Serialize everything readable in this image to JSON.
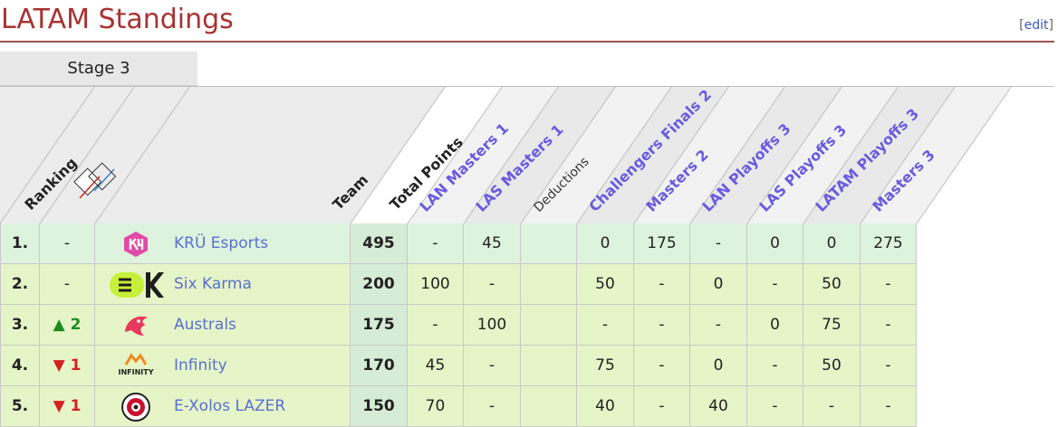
{
  "title": "LATAM Standings",
  "edit": {
    "open": "[",
    "label": "edit",
    "close": "]"
  },
  "tab": {
    "label": "Stage 3"
  },
  "header": {
    "ranking": "Ranking",
    "team": "Team",
    "total_points": "Total Points",
    "columns": [
      "LAN Masters 1",
      "LAS Masters 1",
      "Deductions",
      "Challengers Finals 2",
      "Masters 2",
      "LAN Playoffs 3",
      "LAS Playoffs 3",
      "LATAM Playoffs 3",
      "Masters 3"
    ]
  },
  "colors": {
    "title": "#a83232",
    "link": "#5a6fd0",
    "header_link": "#6a5ae0",
    "row_highlight": "#ddf3dd",
    "row_green": "#e6f5c8",
    "up": "#1d8a1d",
    "down": "#d42020"
  },
  "rows": [
    {
      "rank": "1.",
      "change": "-",
      "change_dir": "none",
      "logo": "kru-logo",
      "team": "KRÜ Esports",
      "total": "495",
      "values": [
        "-",
        "45",
        "",
        "0",
        "175",
        "-",
        "0",
        "0",
        "275"
      ]
    },
    {
      "rank": "2.",
      "change": "-",
      "change_dir": "none",
      "logo": "six-karma-logo",
      "team": "Six Karma",
      "total": "200",
      "values": [
        "100",
        "-",
        "",
        "50",
        "-",
        "0",
        "-",
        "50",
        "-"
      ]
    },
    {
      "rank": "3.",
      "change": "▲ 2",
      "change_dir": "up",
      "logo": "australs-logo",
      "team": "Australs",
      "total": "175",
      "values": [
        "-",
        "100",
        "",
        "-",
        "-",
        "-",
        "0",
        "75",
        "-"
      ]
    },
    {
      "rank": "4.",
      "change": "▼ 1",
      "change_dir": "down",
      "logo": "infinity-logo",
      "team": "Infinity",
      "total": "170",
      "values": [
        "45",
        "-",
        "",
        "75",
        "-",
        "0",
        "-",
        "50",
        "-"
      ]
    },
    {
      "rank": "5.",
      "change": "▼ 1",
      "change_dir": "down",
      "logo": "exolos-logo",
      "team": "E-Xolos LAZER",
      "total": "150",
      "values": [
        "70",
        "-",
        "",
        "40",
        "-",
        "40",
        "-",
        "-",
        "-"
      ]
    }
  ]
}
